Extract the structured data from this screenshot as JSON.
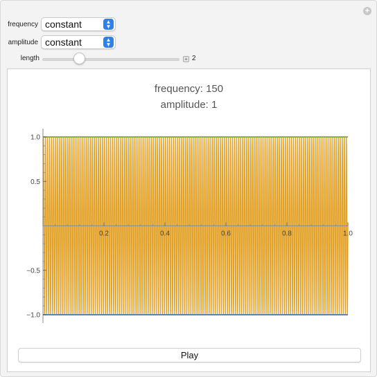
{
  "controls": {
    "frequency": {
      "label": "frequency",
      "value": "constant"
    },
    "amplitude": {
      "label": "amplitude",
      "value": "constant"
    },
    "length": {
      "label": "length",
      "value": "2",
      "fraction": 0.27
    }
  },
  "plot": {
    "title_lines": [
      "frequency: 150",
      "amplitude: 1"
    ]
  },
  "chart_data": {
    "type": "line",
    "title": "",
    "xlabel": "",
    "ylabel": "",
    "xlim": [
      0,
      1
    ],
    "ylim": [
      -1,
      1
    ],
    "xticks": [
      0.2,
      0.4,
      0.6,
      0.8,
      1.0
    ],
    "xtick_labels": [
      "0.2",
      "0.4",
      "0.6",
      "0.8",
      "1.0"
    ],
    "yticks": [
      1.0,
      0.5,
      -0.5,
      -1.0
    ],
    "ytick_labels": [
      "1.0",
      "0.5",
      "−0.5",
      "−1.0"
    ],
    "series": [
      {
        "role": "signal",
        "function": "sin",
        "frequency": 150,
        "amplitude": 1,
        "color": "#e2a025"
      },
      {
        "role": "upper-envelope",
        "values": [
          1,
          1
        ],
        "x": [
          0,
          1
        ],
        "color": "#8fb032"
      },
      {
        "role": "lower-envelope",
        "values": [
          -1,
          -1
        ],
        "x": [
          0,
          1
        ],
        "color": "#5e81b5"
      }
    ],
    "grid": false
  },
  "play": {
    "label": "Play"
  },
  "colors": {
    "signal": "#e2a025",
    "upper": "#8fb032",
    "lower": "#5e81b5",
    "select_accent": "#2f80ed"
  }
}
